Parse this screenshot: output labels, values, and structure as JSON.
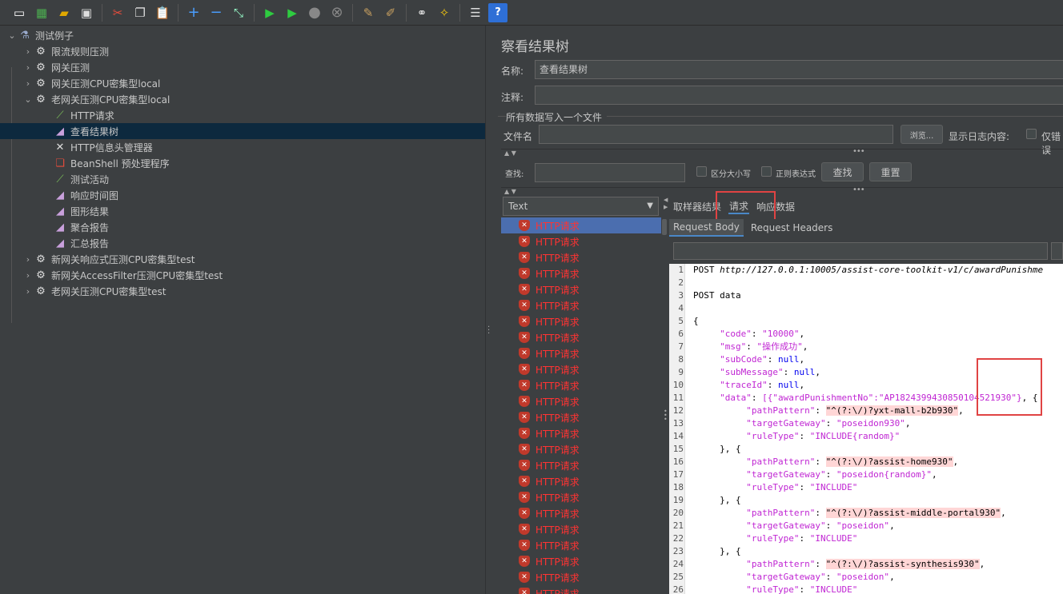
{
  "toolbar": {
    "buttons": [
      "new-icon",
      "templates-icon",
      "open-icon",
      "save-icon",
      "cut-icon",
      "copy-icon",
      "paste-icon",
      "expand-icon",
      "collapse-icon",
      "toggle-icon",
      "start-icon",
      "start-no-pause-icon",
      "stop-icon",
      "shutdown-icon",
      "clear-icon",
      "clear-all-icon",
      "search-icon",
      "reset-search-icon",
      "function-helper-icon",
      "help-icon"
    ]
  },
  "tree": {
    "root": "测试例子",
    "items": [
      {
        "label": "限流规则压测"
      },
      {
        "label": "网关压测"
      },
      {
        "label": "网关压测CPU密集型local"
      },
      {
        "label": "老网关压测CPU密集型local"
      },
      {
        "label": "HTTP请求"
      },
      {
        "label": "查看结果树"
      },
      {
        "label": "HTTP信息头管理器"
      },
      {
        "label": "BeanShell 预处理程序"
      },
      {
        "label": "测试活动"
      },
      {
        "label": "响应时间图"
      },
      {
        "label": "图形结果"
      },
      {
        "label": "聚合报告"
      },
      {
        "label": "汇总报告"
      },
      {
        "label": "新网关响应式压测CPU密集型test"
      },
      {
        "label": "新网关AccessFilter压测CPU密集型test"
      },
      {
        "label": "老网关压测CPU密集型test"
      }
    ]
  },
  "panel": {
    "title": "察看结果树",
    "name_label": "名称:",
    "name_value": "查看结果树",
    "comment_label": "注释:",
    "comment_value": "",
    "file_section": "所有数据写入一个文件",
    "filename_label": "文件名",
    "filename_value": "",
    "browse_button": "浏览...",
    "log_label": "显示日志内容:",
    "errors_only": "仅错误",
    "search_label": "查找:",
    "search_value": "",
    "case_label": "区分大小写",
    "regex_label": "正则表达式",
    "find_button": "查找",
    "reset_button": "重置"
  },
  "renderer": {
    "selected": "Text"
  },
  "results": {
    "item_label": "HTTP请求",
    "count": 24
  },
  "tabs": {
    "main": [
      "取样器结果",
      "请求",
      "响应数据"
    ],
    "active_main": "请求",
    "sub": [
      "Request Body",
      "Request Headers"
    ],
    "active_sub": "Request Body"
  },
  "code": {
    "lines": [
      {
        "n": "1",
        "parts": [
          [
            "plain",
            "POST "
          ],
          [
            "url",
            "http://127.0.0.1:10005/assist-core-toolkit-v1/c/awardPunishme"
          ]
        ]
      },
      {
        "n": "2",
        "parts": []
      },
      {
        "n": "3",
        "parts": [
          [
            "plain",
            "POST data"
          ]
        ]
      },
      {
        "n": "4",
        "parts": []
      },
      {
        "n": "5",
        "parts": [
          [
            "punc",
            "{"
          ]
        ]
      },
      {
        "n": "6",
        "parts": [
          [
            "plain",
            "     "
          ],
          [
            "key",
            "\"code\""
          ],
          [
            "punc",
            ": "
          ],
          [
            "str",
            "\"10000\""
          ],
          [
            "punc",
            ","
          ]
        ]
      },
      {
        "n": "7",
        "parts": [
          [
            "plain",
            "     "
          ],
          [
            "key",
            "\"msg\""
          ],
          [
            "punc",
            ": "
          ],
          [
            "str",
            "\"操作成功\""
          ],
          [
            "punc",
            ","
          ]
        ]
      },
      {
        "n": "8",
        "parts": [
          [
            "plain",
            "     "
          ],
          [
            "key",
            "\"subCode\""
          ],
          [
            "punc",
            ": "
          ],
          [
            "null",
            "null"
          ],
          [
            "punc",
            ","
          ]
        ]
      },
      {
        "n": "9",
        "parts": [
          [
            "plain",
            "     "
          ],
          [
            "key",
            "\"subMessage\""
          ],
          [
            "punc",
            ": "
          ],
          [
            "null",
            "null"
          ],
          [
            "punc",
            ","
          ]
        ]
      },
      {
        "n": "10",
        "parts": [
          [
            "plain",
            "     "
          ],
          [
            "key",
            "\"traceId\""
          ],
          [
            "punc",
            ": "
          ],
          [
            "null",
            "null"
          ],
          [
            "punc",
            ","
          ]
        ]
      },
      {
        "n": "11",
        "parts": [
          [
            "plain",
            "     "
          ],
          [
            "key",
            "\"data\""
          ],
          [
            "punc",
            ": "
          ],
          [
            "str",
            "[{\"awardPunishmentNo\":\"AP1824399430850104521930\"}"
          ],
          [
            "punc",
            ", {"
          ]
        ]
      },
      {
        "n": "12",
        "parts": [
          [
            "plain",
            "          "
          ],
          [
            "key",
            "\"pathPattern\""
          ],
          [
            "punc",
            ": "
          ],
          [
            "hl",
            "\"^(?:\\/)?yxt-mall-b2b930\""
          ],
          [
            "punc",
            ","
          ]
        ]
      },
      {
        "n": "13",
        "parts": [
          [
            "plain",
            "          "
          ],
          [
            "key",
            "\"targetGateway\""
          ],
          [
            "punc",
            ": "
          ],
          [
            "str",
            "\"poseidon930\""
          ],
          [
            "punc",
            ","
          ]
        ]
      },
      {
        "n": "14",
        "parts": [
          [
            "plain",
            "          "
          ],
          [
            "key",
            "\"ruleType\""
          ],
          [
            "punc",
            ": "
          ],
          [
            "str",
            "\"INCLUDE{random}\""
          ]
        ]
      },
      {
        "n": "15",
        "parts": [
          [
            "plain",
            "     "
          ],
          [
            "punc",
            "}, {"
          ]
        ]
      },
      {
        "n": "16",
        "parts": [
          [
            "plain",
            "          "
          ],
          [
            "key",
            "\"pathPattern\""
          ],
          [
            "punc",
            ": "
          ],
          [
            "hl",
            "\"^(?:\\/)?assist-home930\""
          ],
          [
            "punc",
            ","
          ]
        ]
      },
      {
        "n": "17",
        "parts": [
          [
            "plain",
            "          "
          ],
          [
            "key",
            "\"targetGateway\""
          ],
          [
            "punc",
            ": "
          ],
          [
            "str",
            "\"poseidon{random}\""
          ],
          [
            "punc",
            ","
          ]
        ]
      },
      {
        "n": "18",
        "parts": [
          [
            "plain",
            "          "
          ],
          [
            "key",
            "\"ruleType\""
          ],
          [
            "punc",
            ": "
          ],
          [
            "str",
            "\"INCLUDE\""
          ]
        ]
      },
      {
        "n": "19",
        "parts": [
          [
            "plain",
            "     "
          ],
          [
            "punc",
            "}, {"
          ]
        ]
      },
      {
        "n": "20",
        "parts": [
          [
            "plain",
            "          "
          ],
          [
            "key",
            "\"pathPattern\""
          ],
          [
            "punc",
            ": "
          ],
          [
            "hl",
            "\"^(?:\\/)?assist-middle-portal930\""
          ],
          [
            "punc",
            ","
          ]
        ]
      },
      {
        "n": "21",
        "parts": [
          [
            "plain",
            "          "
          ],
          [
            "key",
            "\"targetGateway\""
          ],
          [
            "punc",
            ": "
          ],
          [
            "str",
            "\"poseidon\""
          ],
          [
            "punc",
            ","
          ]
        ]
      },
      {
        "n": "22",
        "parts": [
          [
            "plain",
            "          "
          ],
          [
            "key",
            "\"ruleType\""
          ],
          [
            "punc",
            ": "
          ],
          [
            "str",
            "\"INCLUDE\""
          ]
        ]
      },
      {
        "n": "23",
        "parts": [
          [
            "plain",
            "     "
          ],
          [
            "punc",
            "}, {"
          ]
        ]
      },
      {
        "n": "24",
        "parts": [
          [
            "plain",
            "          "
          ],
          [
            "key",
            "\"pathPattern\""
          ],
          [
            "punc",
            ": "
          ],
          [
            "hl",
            "\"^(?:\\/)?assist-synthesis930\""
          ],
          [
            "punc",
            ","
          ]
        ]
      },
      {
        "n": "25",
        "parts": [
          [
            "plain",
            "          "
          ],
          [
            "key",
            "\"targetGateway\""
          ],
          [
            "punc",
            ": "
          ],
          [
            "str",
            "\"poseidon\""
          ],
          [
            "punc",
            ","
          ]
        ]
      },
      {
        "n": "26",
        "parts": [
          [
            "plain",
            "          "
          ],
          [
            "key",
            "\"ruleType\""
          ],
          [
            "punc",
            ": "
          ],
          [
            "str",
            "\"INCLUDE\""
          ]
        ]
      }
    ]
  },
  "colors": {
    "bg": "#3c3f41",
    "selection": "#0d293e",
    "list_selection": "#4b6eaf",
    "error_red": "#ff3333",
    "annotation_red": "#e04343"
  }
}
